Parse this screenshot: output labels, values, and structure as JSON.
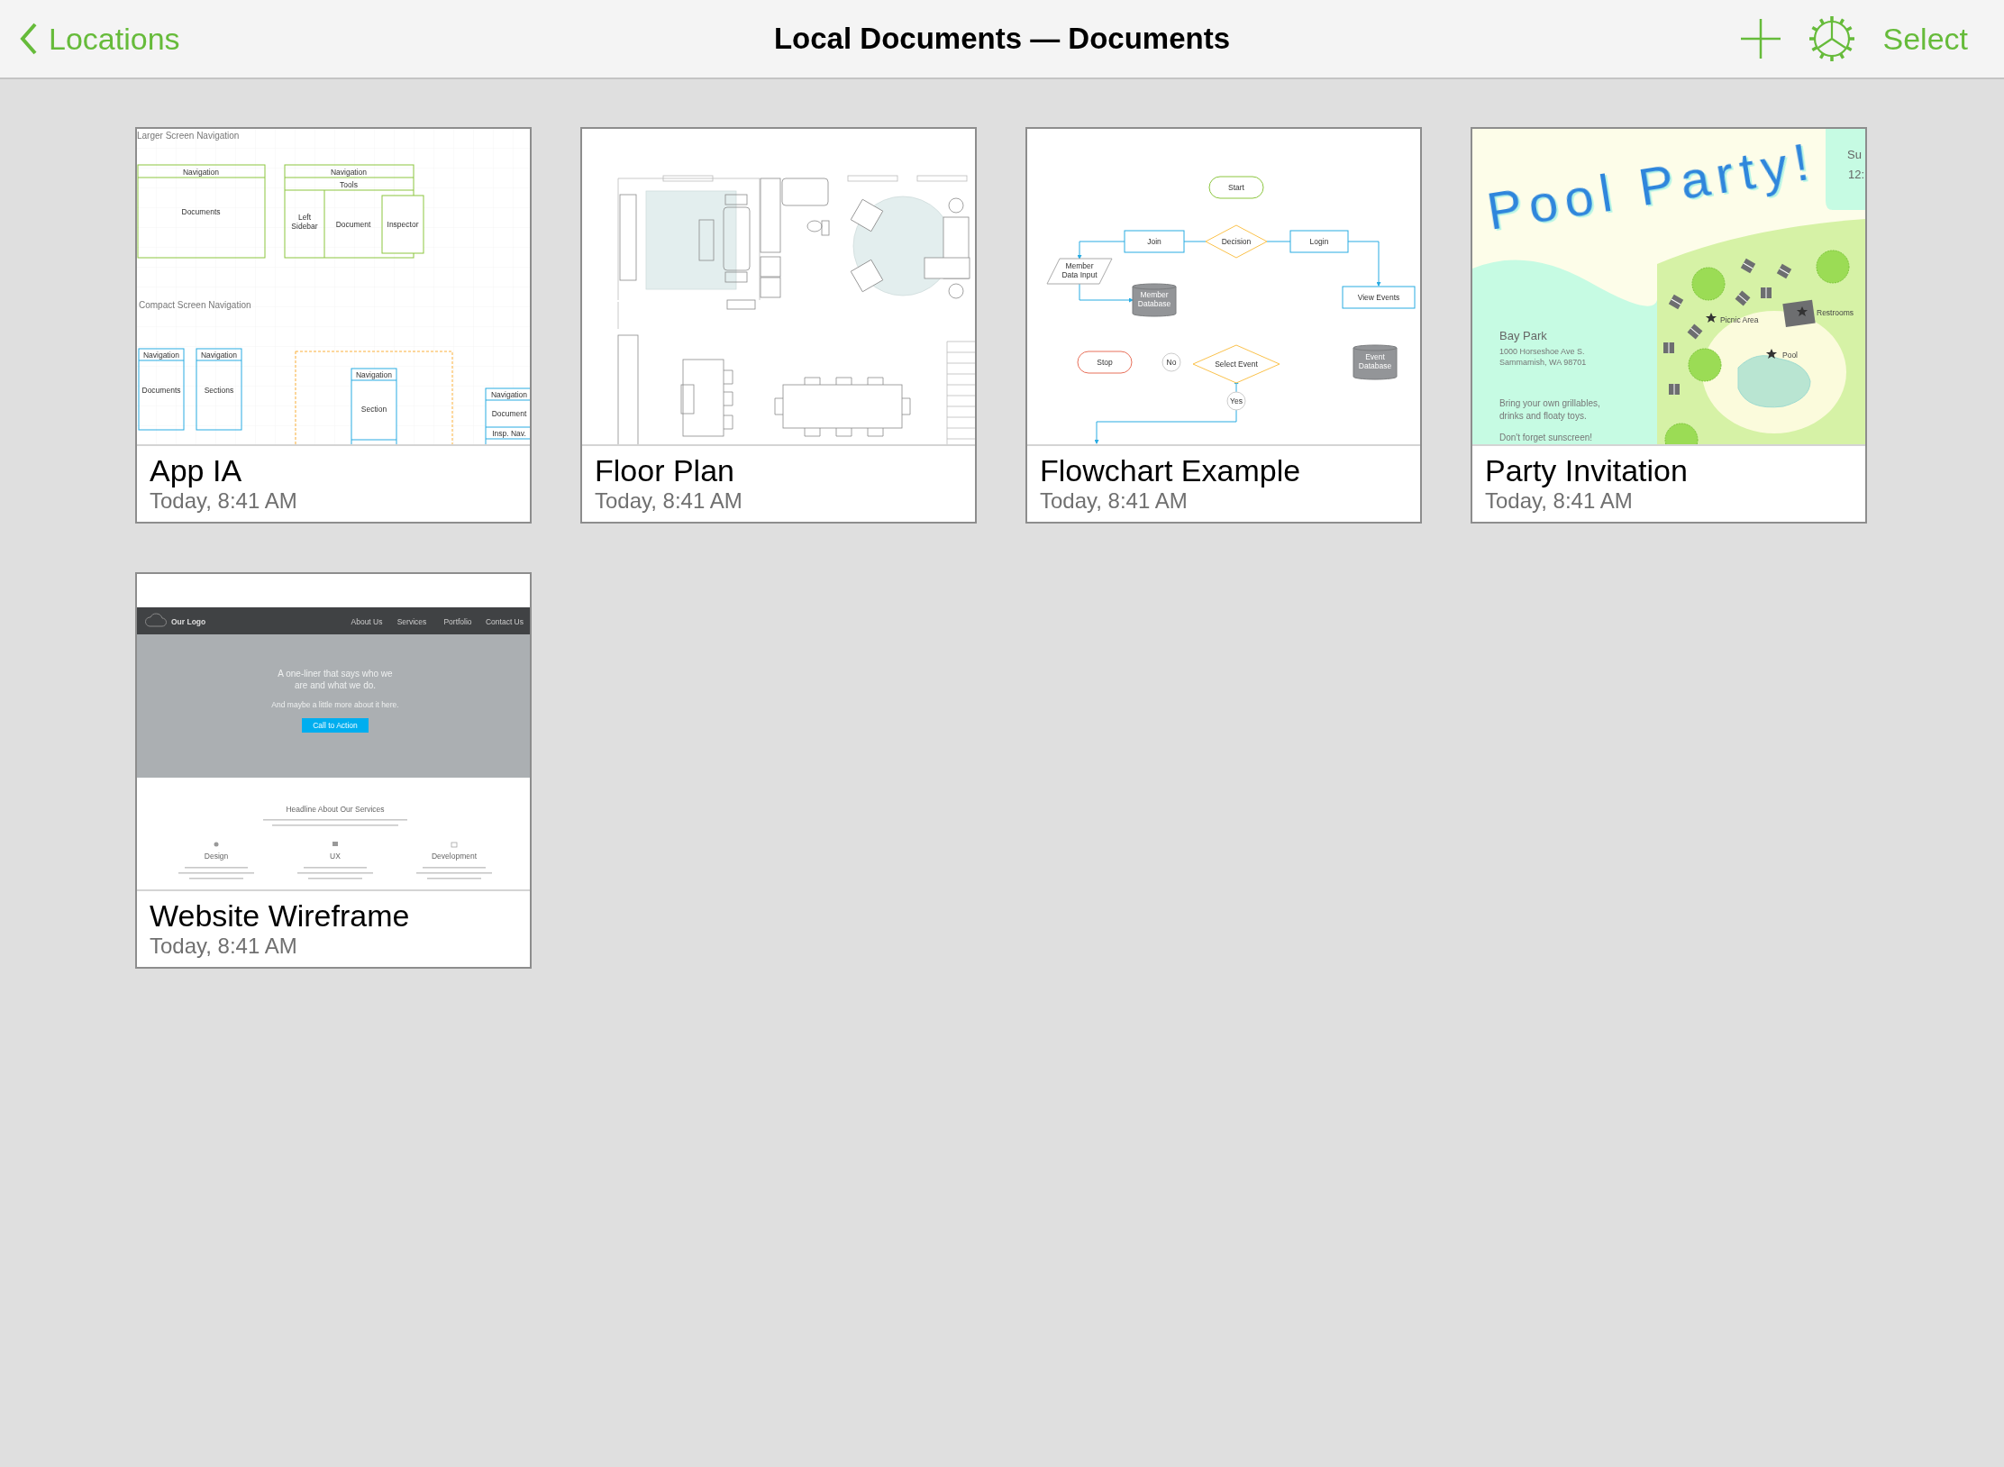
{
  "navigation_bar": {
    "back_label": "Locations",
    "title": "Local Documents — Documents",
    "select_label": "Select"
  },
  "documents": [
    {
      "title": "App IA",
      "date": "Today, 8:41 AM",
      "preview": {
        "kind": "app-ia",
        "headings": [
          "Larger Screen Navigation",
          "Compact Screen Navigation"
        ],
        "labels": [
          "Navigation",
          "Documents",
          "Navigation",
          "Tools",
          "Left Sidebar",
          "Document",
          "Inspector",
          "Navigation",
          "Documents",
          "Navigation",
          "Sections",
          "Navigation",
          "Section",
          "Navigation",
          "Document",
          "Insp. Nav."
        ]
      }
    },
    {
      "title": "Floor Plan",
      "date": "Today, 8:41 AM",
      "preview": {
        "kind": "floor-plan"
      }
    },
    {
      "title": "Flowchart Example",
      "date": "Today, 8:41 AM",
      "preview": {
        "kind": "flowchart",
        "labels": [
          "Start",
          "Join",
          "Decision",
          "Login",
          "Member Data Input",
          "Member Database",
          "View Events",
          "Stop",
          "No",
          "Select Event",
          "Event Database",
          "Yes"
        ]
      }
    },
    {
      "title": "Party Invitation",
      "date": "Today, 8:41 AM",
      "preview": {
        "kind": "invitation",
        "headline": "Pool Party!",
        "corner_lines": [
          "Su",
          "12:"
        ],
        "place": "Bay Park",
        "address_lines": [
          "1000 Horseshoe Ave S.",
          "Sammamish, WA 98701"
        ],
        "notes": [
          "Bring your own grillables, drinks and floaty toys.",
          "Don't forget sunscreen!"
        ],
        "map_labels": [
          "Picnic Area",
          "Restrooms",
          "Pool"
        ]
      }
    },
    {
      "title": "Website Wireframe",
      "date": "Today, 8:41 AM",
      "preview": {
        "kind": "wireframe",
        "logo": "Our Logo",
        "nav": [
          "About Us",
          "Services",
          "Portfolio",
          "Contact Us"
        ],
        "tagline": "A one-liner that says who we are and what we do.",
        "subline": "And maybe a little more about it here.",
        "button": "Call to Action",
        "section_heading": "Headline About Our Services",
        "features": [
          "Design",
          "UX",
          "Development"
        ]
      }
    }
  ]
}
